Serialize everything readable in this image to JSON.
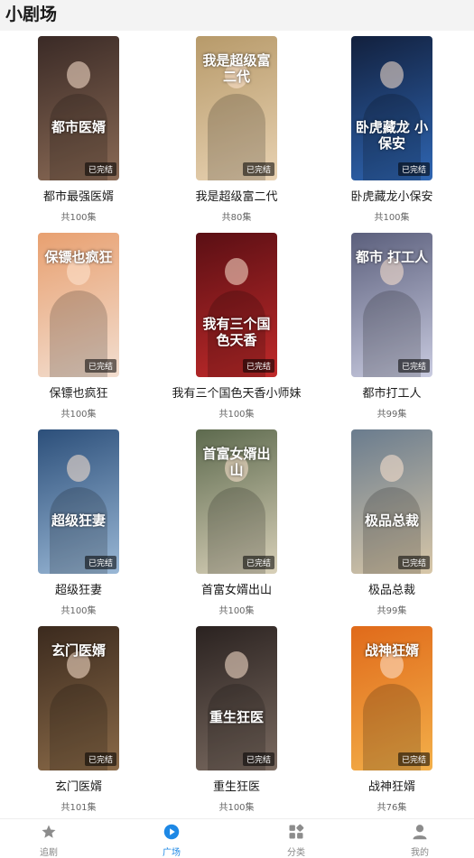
{
  "header": {
    "title": "小剧场"
  },
  "badge_text": "已完结",
  "dramas": [
    {
      "name": "都市最强医婿",
      "episodes": "共100集",
      "poster_title": "都市医婿",
      "colors": [
        "#3a2a26",
        "#8a6a55"
      ]
    },
    {
      "name": "我是超级富二代",
      "episodes": "共80集",
      "poster_title": "我是超级富二代",
      "colors": [
        "#b79a6a",
        "#e8d2b2"
      ]
    },
    {
      "name": "卧虎藏龙小保安",
      "episodes": "共100集",
      "poster_title": "卧虎藏龙 小保安",
      "colors": [
        "#12203d",
        "#2f66b3"
      ]
    },
    {
      "name": "保镖也疯狂",
      "episodes": "共100集",
      "poster_title": "保镖也疯狂",
      "colors": [
        "#e8a070",
        "#f2ded0"
      ]
    },
    {
      "name": "我有三个国色天香小师妹",
      "episodes": "共100集",
      "poster_title": "我有三个国色天香",
      "colors": [
        "#5a0f14",
        "#c02a2a"
      ]
    },
    {
      "name": "都市打工人",
      "episodes": "共99集",
      "poster_title": "都市 打工人",
      "colors": [
        "#5b5f7c",
        "#c9cbe0"
      ]
    },
    {
      "name": "超级狂妻",
      "episodes": "共100集",
      "poster_title": "超级狂妻",
      "colors": [
        "#2c4f7a",
        "#9ab8d6"
      ]
    },
    {
      "name": "首富女婿出山",
      "episodes": "共100集",
      "poster_title": "首富女婿出山",
      "colors": [
        "#5d6a4e",
        "#d8d0b8"
      ]
    },
    {
      "name": "极品总裁",
      "episodes": "共99集",
      "poster_title": "极品总裁",
      "colors": [
        "#6a7c8e",
        "#d8c7a8"
      ]
    },
    {
      "name": "玄门医婿",
      "episodes": "共101集",
      "poster_title": "玄门医婿",
      "colors": [
        "#3b2a1e",
        "#8a6a48"
      ]
    },
    {
      "name": "重生狂医",
      "episodes": "共100集",
      "poster_title": "重生狂医",
      "colors": [
        "#2a2220",
        "#7a6a60"
      ]
    },
    {
      "name": "战神狂婿",
      "episodes": "共76集",
      "poster_title": "战神狂婿",
      "colors": [
        "#e06a1a",
        "#f3b04a"
      ]
    }
  ],
  "tabs": [
    {
      "label": "追剧",
      "icon": "star-icon"
    },
    {
      "label": "广场",
      "icon": "play-circle-icon"
    },
    {
      "label": "分类",
      "icon": "grid-icon"
    },
    {
      "label": "我的",
      "icon": "person-icon"
    }
  ],
  "active_tab": "广场",
  "accent_color": "#1e88e5"
}
